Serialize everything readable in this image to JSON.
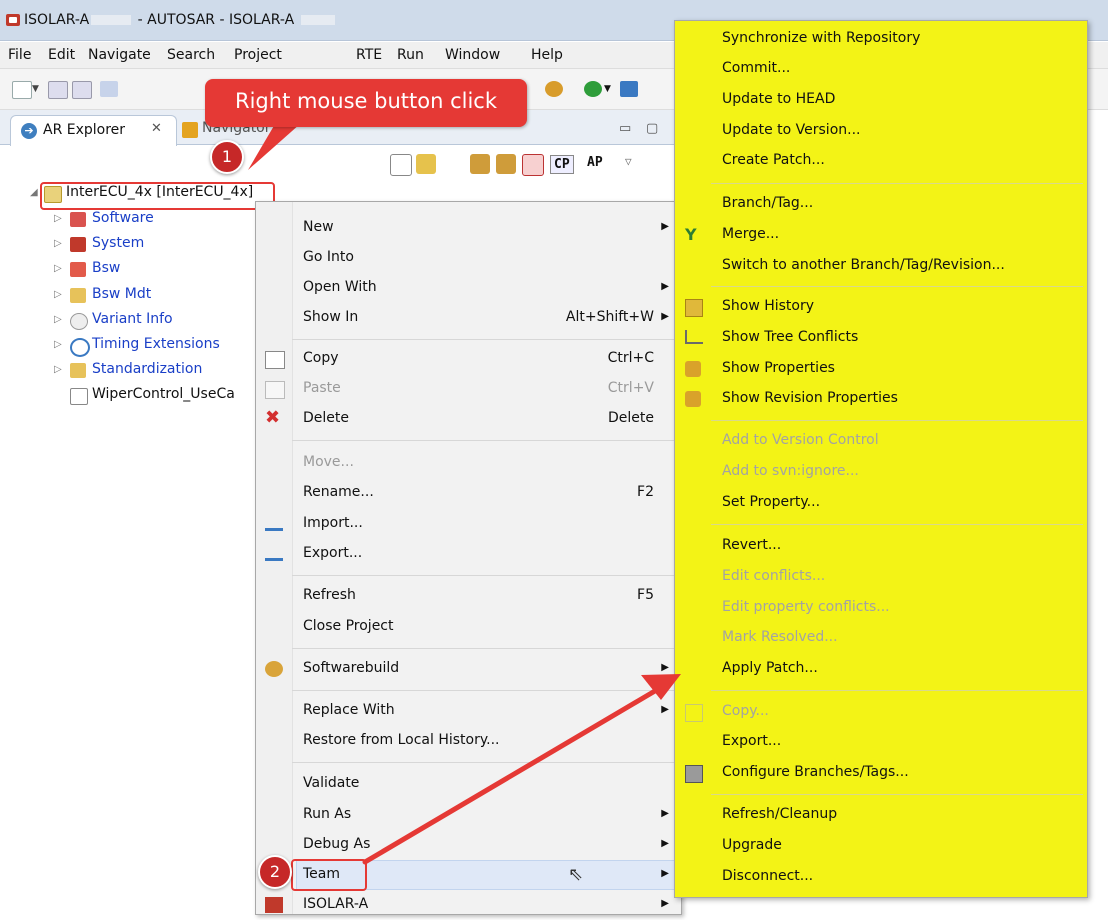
{
  "window": {
    "title_prefix": "ISOLAR-A",
    "title_mid": "- AUTOSAR - ISOLAR-A"
  },
  "menubar": [
    "File",
    "Edit",
    "Navigate",
    "Search",
    "Project",
    "RTE",
    "Run",
    "Window",
    "Help"
  ],
  "tabs": {
    "active_label": "AR Explorer",
    "active_close": "✕",
    "inactive_label": "Navigator"
  },
  "view_toolbar": {
    "cp": "CP",
    "ap": "AP"
  },
  "tree": {
    "root": "InterECU_4x [InterECU_4x]",
    "items": [
      "Software",
      "System",
      "Bsw",
      "Bsw Mdt",
      "Variant Info",
      "Timing Extensions",
      "Standardization",
      "WiperControl_UseCa"
    ]
  },
  "context_menu": {
    "items": [
      {
        "label": "New",
        "accel": "",
        "sub": true,
        "disabled": false
      },
      {
        "label": "Go Into",
        "accel": "",
        "sub": false,
        "disabled": false
      },
      {
        "label": "Open With",
        "accel": "",
        "sub": true,
        "disabled": false
      },
      {
        "label": "Show In",
        "accel": "Alt+Shift+W",
        "sub": true,
        "disabled": false
      },
      {
        "label": "Copy",
        "accel": "Ctrl+C",
        "sub": false,
        "disabled": false
      },
      {
        "label": "Paste",
        "accel": "Ctrl+V",
        "sub": false,
        "disabled": true
      },
      {
        "label": "Delete",
        "accel": "Delete",
        "sub": false,
        "disabled": false
      },
      {
        "label": "Move...",
        "accel": "",
        "sub": false,
        "disabled": true
      },
      {
        "label": "Rename...",
        "accel": "F2",
        "sub": false,
        "disabled": false
      },
      {
        "label": "Import...",
        "accel": "",
        "sub": false,
        "disabled": false
      },
      {
        "label": "Export...",
        "accel": "",
        "sub": false,
        "disabled": false
      },
      {
        "label": "Refresh",
        "accel": "F5",
        "sub": false,
        "disabled": false
      },
      {
        "label": "Close Project",
        "accel": "",
        "sub": false,
        "disabled": false
      },
      {
        "label": "Softwarebuild",
        "accel": "",
        "sub": true,
        "disabled": false
      },
      {
        "label": "Replace With",
        "accel": "",
        "sub": true,
        "disabled": false
      },
      {
        "label": "Restore from Local History...",
        "accel": "",
        "sub": false,
        "disabled": false
      },
      {
        "label": "Validate",
        "accel": "",
        "sub": false,
        "disabled": false
      },
      {
        "label": "Run As",
        "accel": "",
        "sub": true,
        "disabled": false
      },
      {
        "label": "Debug As",
        "accel": "",
        "sub": true,
        "disabled": false
      },
      {
        "label": "Team",
        "accel": "",
        "sub": true,
        "disabled": false
      },
      {
        "label": "ISOLAR-A",
        "accel": "",
        "sub": true,
        "disabled": false
      }
    ]
  },
  "team_submenu": {
    "items": [
      {
        "label": "Synchronize with Repository",
        "disabled": false
      },
      {
        "label": "Commit...",
        "disabled": false
      },
      {
        "label": "Update to HEAD",
        "disabled": false
      },
      {
        "label": "Update to Version...",
        "disabled": false
      },
      {
        "label": "Create Patch...",
        "disabled": false
      },
      {
        "label": "Branch/Tag...",
        "disabled": false
      },
      {
        "label": "Merge...",
        "disabled": false
      },
      {
        "label": "Switch to another Branch/Tag/Revision...",
        "disabled": false
      },
      {
        "label": "Show History",
        "disabled": false
      },
      {
        "label": "Show Tree Conflicts",
        "disabled": false
      },
      {
        "label": "Show Properties",
        "disabled": false
      },
      {
        "label": "Show Revision Properties",
        "disabled": false
      },
      {
        "label": "Add to Version Control",
        "disabled": true
      },
      {
        "label": "Add to svn:ignore...",
        "disabled": true
      },
      {
        "label": "Set Property...",
        "disabled": false
      },
      {
        "label": "Revert...",
        "disabled": false
      },
      {
        "label": "Edit conflicts...",
        "disabled": true
      },
      {
        "label": "Edit property conflicts...",
        "disabled": true
      },
      {
        "label": "Mark Resolved...",
        "disabled": true
      },
      {
        "label": "Apply Patch...",
        "disabled": false
      },
      {
        "label": "Copy...",
        "disabled": true
      },
      {
        "label": "Export...",
        "disabled": false
      },
      {
        "label": "Configure Branches/Tags...",
        "disabled": false
      },
      {
        "label": "Refresh/Cleanup",
        "disabled": false
      },
      {
        "label": "Upgrade",
        "disabled": false
      },
      {
        "label": "Disconnect...",
        "disabled": false
      }
    ]
  },
  "annotations": {
    "callout_text": "Right mouse button click",
    "badge1": "1",
    "badge2": "2"
  },
  "colors": {
    "highlight_yellow": "#f3f316",
    "annotation_red": "#e53935",
    "tree_link_blue": "#1a3fc7"
  }
}
